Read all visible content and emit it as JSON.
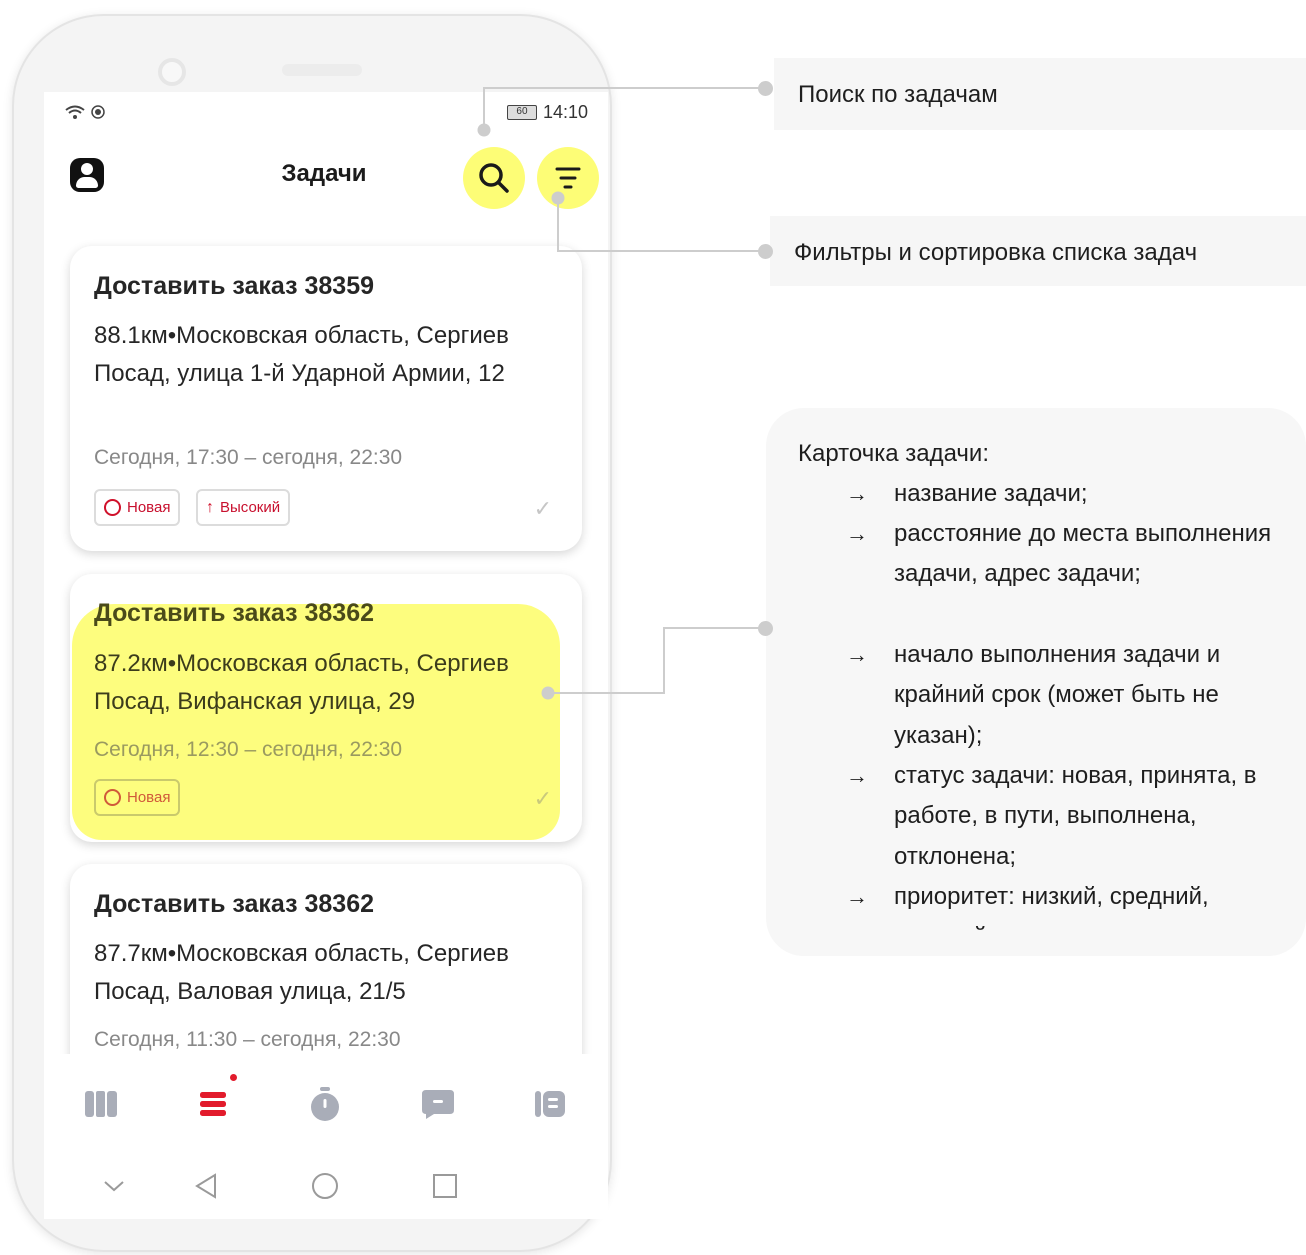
{
  "status_bar": {
    "left_icons": "wifi-icon, record-icon",
    "battery": "60",
    "time": "14:10"
  },
  "header": {
    "title": "Задачи",
    "profile_icon": "account-icon",
    "search_icon": "search-icon",
    "filter_icon": "filter-icon"
  },
  "tasks": [
    {
      "title": "Доставить заказ 38359",
      "address": "88.1км•Московская область, Сергиев Посад, улица 1-й Ударной Армии, 12",
      "time": "Сегодня, 17:30 – сегодня, 22:30",
      "status": "Новая",
      "priority": "Высокий"
    },
    {
      "title": "Доставить заказ 38362",
      "address": "87.2км•Московская область, Сергиев Посад, Вифанская улица, 29",
      "time": "Сегодня, 12:30 – сегодня, 22:30",
      "status": "Новая"
    },
    {
      "title": "Доставить заказ 38362",
      "address": "87.7км•Московская область, Сергиев Посад, Валовая улица, 21/5",
      "time": "Сегодня, 11:30 – сегодня, 22:30"
    }
  ],
  "bottom_nav": {
    "items": [
      "map-icon",
      "tasks-list-icon",
      "stopwatch-icon",
      "chat-icon",
      "book-icon"
    ],
    "active": "tasks-list-icon",
    "colors": {
      "active": "#e21b2c",
      "inactive": "#a9adb8"
    }
  },
  "annotations": {
    "search": "Поиск по задачам",
    "filters": "Фильтры и сортировка списка задач",
    "card": {
      "title": "Карточка задачи:",
      "items": [
        "название задачи;",
        "расстояние до места выполнения задачи, адрес задачи;",
        "начало выполнения задачи и крайний срок (может быть не указан);",
        "статус задачи: новая, принята, в работе, в пути, выполнена, отклонена;",
        "приоритет: низкий, средний, высокий"
      ],
      "arrow": "→"
    }
  },
  "colors": {
    "highlight": "#fdfd76",
    "accent_red": "#e21b2c",
    "connector": "#cdcdcd"
  }
}
